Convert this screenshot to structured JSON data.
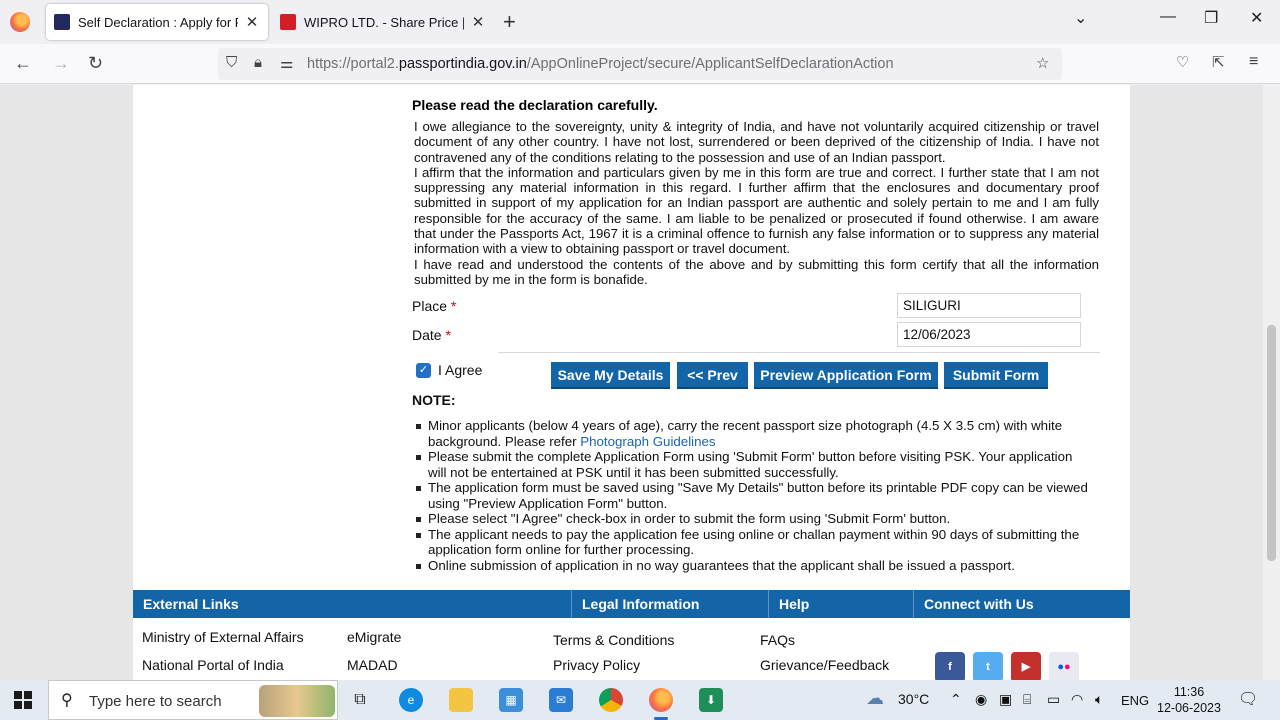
{
  "browser": {
    "tabs": [
      {
        "title": "Self Declaration : Apply for Fresh Passport",
        "active": true
      },
      {
        "title": "WIPRO LTD. - Share Price | Ratios",
        "active": false
      }
    ],
    "url_prefix": "https://portal2.",
    "url_domain": "passportindia.gov.in",
    "url_path": "/AppOnlineProject/secure/ApplicantSelfDeclarationAction"
  },
  "declaration": {
    "heading": "Please read the declaration carefully.",
    "paragraphs": [
      "I owe allegiance to the sovereignty, unity & integrity of India, and have not voluntarily acquired citizenship or travel document of any other country. I have not lost, surrendered or been deprived of the citizenship of India. I have not contravened any of the conditions relating to the possession and use of an Indian passport.",
      "I affirm that the information and particulars given by me in this form are true and correct. I further state that I am not suppressing any material information in this regard. I further affirm that the enclosures and documentary proof submitted in support of my application for an Indian passport are authentic and solely pertain to me and I am fully responsible for the accuracy of the same. I am liable to be penalized or prosecuted if found otherwise. I am aware that under the Passports Act, 1967 it is a criminal offence to furnish any false information or to suppress any material information with a view to obtaining passport or travel document.",
      "I have read and understood the contents of the above and by submitting this form certify that all the information submitted by me in the form is bonafide."
    ]
  },
  "form": {
    "place_label": "Place",
    "place_value": "SILIGURI",
    "date_label": "Date",
    "date_value": "12/06/2023",
    "required_mark": "*",
    "agree_label": "I Agree",
    "agree_checked": true
  },
  "buttons": {
    "save": "Save My Details",
    "prev": "<< Prev",
    "preview": "Preview Application Form",
    "submit": "Submit Form"
  },
  "note": {
    "title": "NOTE:",
    "item1_text": "Minor applicants (below 4 years of age), carry the recent passport size photograph (4.5 X 3.5 cm) with white background. Please refer ",
    "item1_link": "Photograph Guidelines",
    "items": [
      "Please submit the complete Application Form using 'Submit Form' button before visiting PSK. Your application will not be entertained at PSK until it has been submitted successfully.",
      "The application form must be saved using \"Save My Details\" button before its printable PDF copy can be viewed using \"Preview Application Form\" button.",
      "Please select \"I Agree\" check-box in order to submit the form using 'Submit Form' button.",
      "The applicant needs to pay the application fee using online or challan payment within 90 days of submitting the application form online for further processing.",
      "Online submission of application in no way guarantees that the applicant shall be issued a passport."
    ]
  },
  "footer": {
    "headers": [
      "External Links",
      "Legal Information",
      "Help",
      "Connect with Us"
    ],
    "external_links": [
      "Ministry of External Affairs",
      "National Portal of India",
      "eMigrate",
      "MADAD"
    ],
    "legal_links": [
      "Terms & Conditions",
      "Privacy Policy"
    ],
    "help_links": [
      "FAQs",
      "Grievance/Feedback"
    ],
    "social": [
      "facebook-icon",
      "twitter-icon",
      "youtube-icon",
      "flickr-icon"
    ]
  },
  "taskbar": {
    "search_placeholder": "Type here to search",
    "weather": "30°C",
    "language": "ENG",
    "time": "11:36",
    "date": "12-06-2023"
  },
  "colors": {
    "primary_button": "#1465a7",
    "footer_bar": "#1465a7",
    "link": "#1a64b0",
    "required": "#dd0000"
  }
}
